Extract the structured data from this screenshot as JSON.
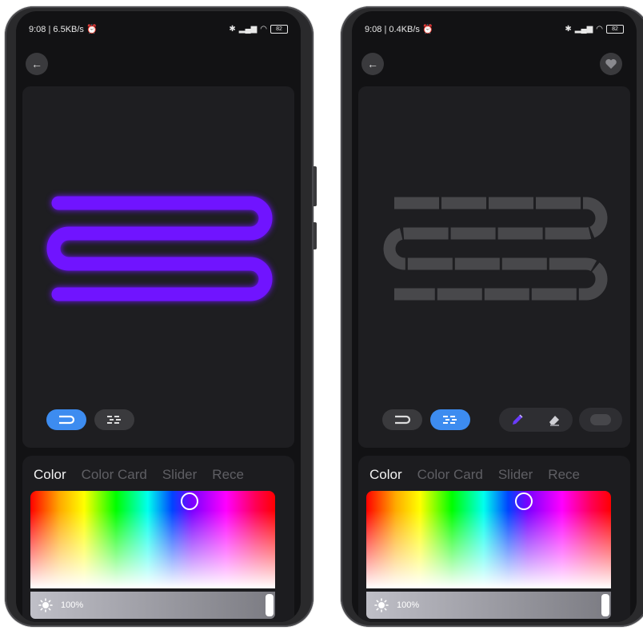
{
  "left_phone": {
    "status": {
      "time": "9:08",
      "speed": "6.5KB/s",
      "battery": "82"
    },
    "back_label": "←",
    "modes": [
      {
        "name": "curve-strip",
        "active": true
      },
      {
        "name": "segment-strip",
        "active": false
      }
    ],
    "strip_color": "#7014ff",
    "tabs": [
      "Color",
      "Color Card",
      "Slider",
      "Rece"
    ],
    "selected_tab": "Color",
    "brightness_text": "100%",
    "brightness_value": 100
  },
  "right_phone": {
    "status": {
      "time": "9:08",
      "speed": "0.4KB/s",
      "battery": "82"
    },
    "back_label": "←",
    "favorite_icon": "heart-icon",
    "modes": [
      {
        "name": "curve-strip",
        "active": false
      },
      {
        "name": "segment-strip",
        "active": true
      }
    ],
    "tools": [
      "pencil-icon",
      "eraser-icon"
    ],
    "strip_color": "#48484b",
    "tabs": [
      "Color",
      "Color Card",
      "Slider",
      "Rece"
    ],
    "selected_tab": "Color",
    "brightness_text": "100%",
    "brightness_value": 100
  },
  "colors": {
    "accent": "#3d8cf0",
    "background": "#121214",
    "card": "#1e1e21"
  }
}
